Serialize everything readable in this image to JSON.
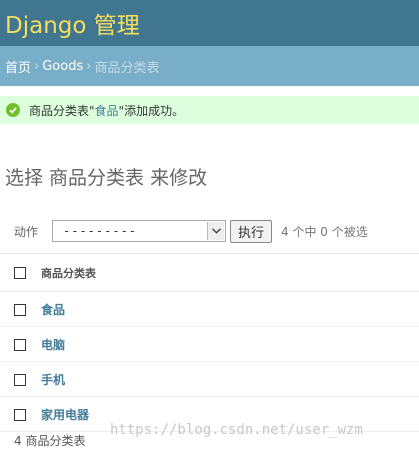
{
  "header": {
    "title": "Django 管理"
  },
  "breadcrumbs": {
    "home": "首页",
    "app": "Goods",
    "model": "商品分类表",
    "sep": "›"
  },
  "message": {
    "prefix": "商品分类表\"",
    "link": "食品",
    "suffix": "\"添加成功。"
  },
  "page_title": "选择 商品分类表 来修改",
  "actions": {
    "label": "动作",
    "selected_value": "---------",
    "run_label": "执行",
    "counter": "4 个中 0 个被选"
  },
  "table": {
    "header": "商品分类表",
    "rows": [
      "食品",
      "电脑",
      "手机",
      "家用电器"
    ]
  },
  "paginator": "4 商品分类表",
  "watermark": "https://blog.csdn.net/user_wzm",
  "colors": {
    "header_bg": "#417690",
    "header_text": "#f5dd5d",
    "breadcrumb_bg": "#79aec8",
    "success_bg": "#dfd",
    "link": "#447e9b"
  },
  "icons": {
    "success": "check-circle-icon",
    "dropdown": "chevron-down-icon"
  }
}
